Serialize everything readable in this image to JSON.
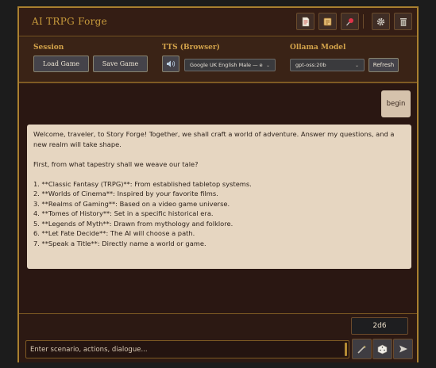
{
  "app": {
    "title": "AI TRPG Forge"
  },
  "header": {
    "icons": [
      "document-icon",
      "scroll-icon",
      "pin-icon",
      "gear-icon",
      "trash-icon"
    ]
  },
  "session": {
    "label": "Session",
    "load_label": "Load Game",
    "save_label": "Save Game"
  },
  "tts": {
    "label": "TTS (Browser)",
    "voice": "Google UK English Male — en-GB"
  },
  "ollama": {
    "label": "Ollama Model",
    "model": "gpt-oss:20b",
    "refresh_label": "Refresh"
  },
  "chat": {
    "user_message": "begin",
    "bot_intro": "Welcome, traveler, to Story Forge! Together, we shall craft a world of adventure. Answer my questions, and a new realm will take shape.",
    "bot_question": "First, from what tapestry shall we weave our tale?",
    "options": [
      "1.  **Classic Fantasy (TRPG)**: From established tabletop systems.",
      "2.  **Worlds of Cinema**: Inspired by your favorite films.",
      "3.  **Realms of Gaming**: Based on a video game universe.",
      "4.  **Tomes of History**: Set in a specific historical era.",
      "5.  **Legends of Myth**: Drawn from mythology and folklore.",
      "6.  **Let Fate Decide**: The AI will choose a path.",
      "7.  **Speak a Title**: Directly name a world or game."
    ]
  },
  "footer": {
    "dice_value": "2d6",
    "input_placeholder": "Enter scenario, actions, dialogue...",
    "buttons": [
      "wand-icon",
      "dice-icon",
      "send-icon"
    ]
  },
  "colors": {
    "accent": "#a9802f",
    "background": "#2a1712",
    "bubble": "#e6d6c1"
  }
}
